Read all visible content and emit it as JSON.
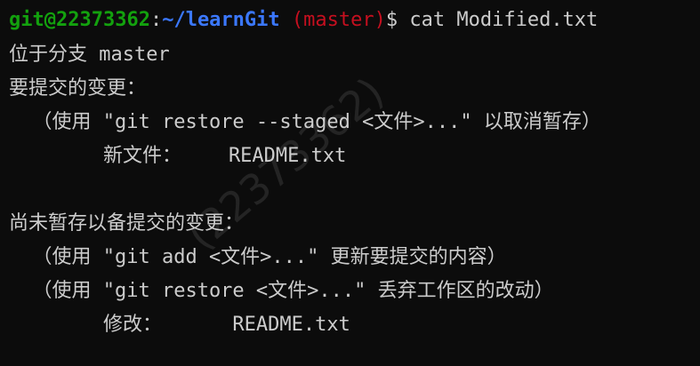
{
  "prompt": {
    "user_host": "git@22373362",
    "colon": ":",
    "path": "~/learnGit",
    "branch": "(master)",
    "symbol": "$",
    "command": "cat Modified.txt"
  },
  "output": {
    "line1": "位于分支 master",
    "line2": "要提交的变更：",
    "line3": "  （使用 \"git restore --staged <文件>...\" 以取消暂存）",
    "line4": "        新文件：    README.txt",
    "line5": "",
    "line6": "尚未暂存以备提交的变更：",
    "line7": "  （使用 \"git add <文件>...\" 更新要提交的内容）",
    "line8": "  （使用 \"git restore <文件>...\" 丢弃工作区的改动）",
    "line9": "        修改：      README.txt"
  },
  "watermark": "(22373362)",
  "colors": {
    "background": "#0c0c0c",
    "text": "#cccccc",
    "user_host": "#13a10e",
    "path": "#3b78ff",
    "branch": "#c50f1f"
  }
}
